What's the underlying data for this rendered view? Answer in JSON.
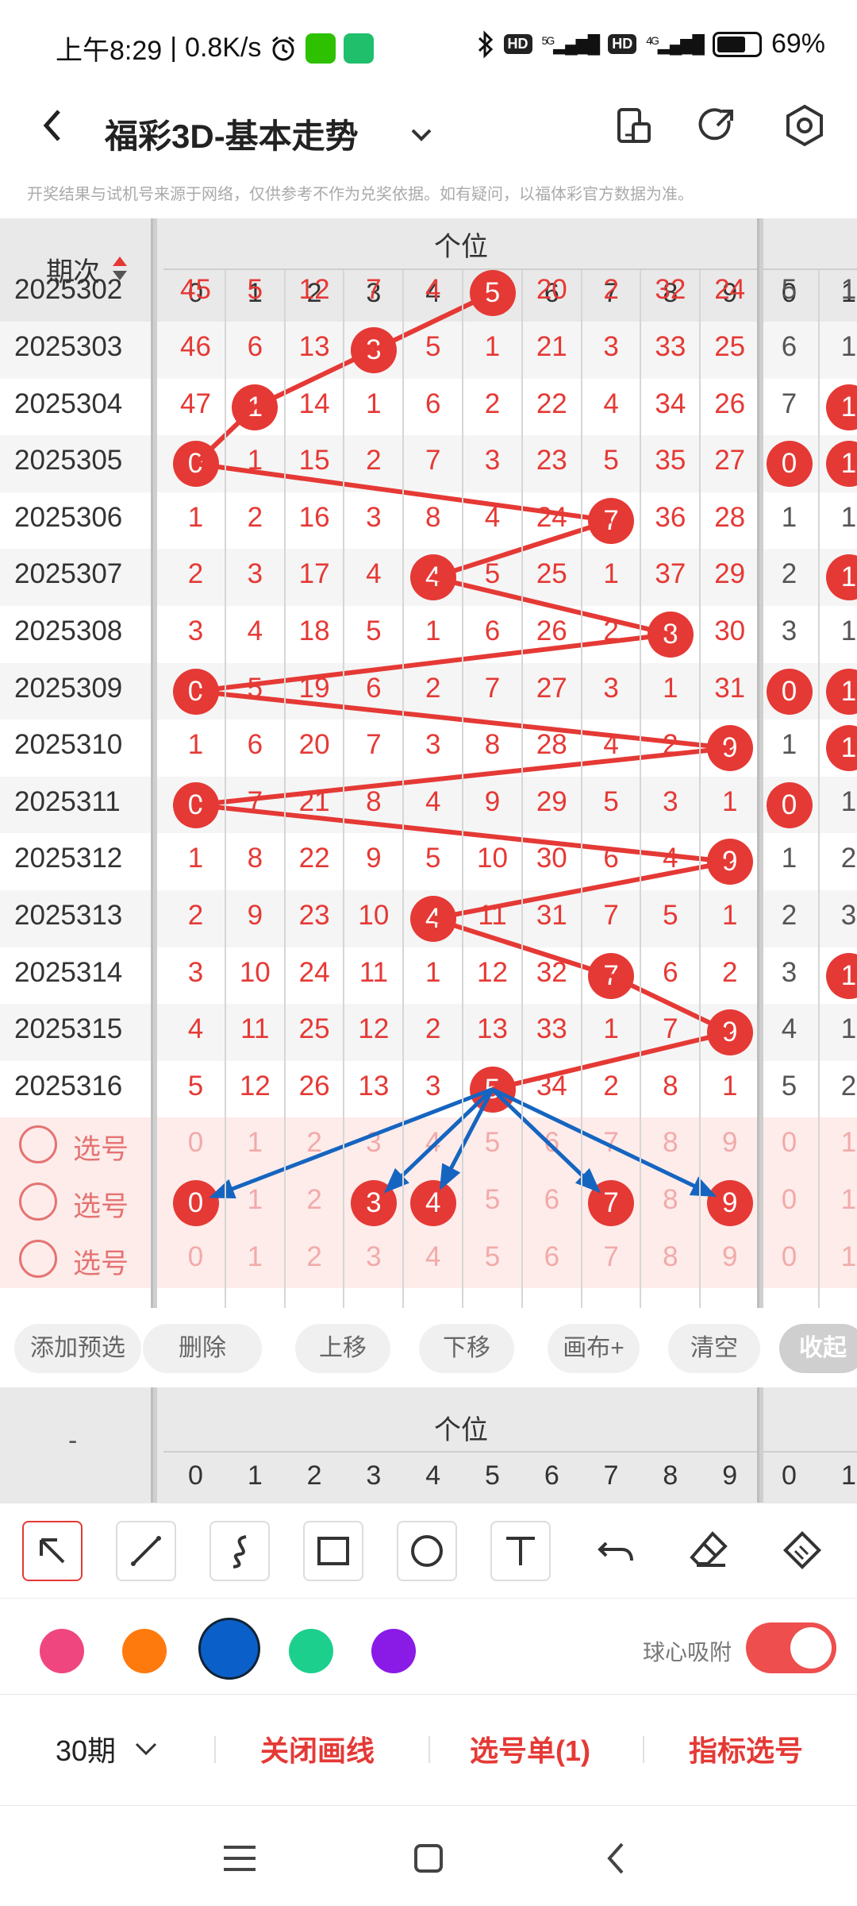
{
  "status_bar": {
    "time": "上午8:29",
    "speed": "0.8K/s",
    "net1": "5G",
    "net2": "4G",
    "hd": "HD",
    "battery": "69%"
  },
  "header": {
    "title": "福彩3D-基本走势",
    "back_icon": "chevron-left-icon"
  },
  "notice": "开奖结果与试机号来源于网络，仅供参考不作为兑奖依据。如有疑问，以福体彩官方数据为准。",
  "table": {
    "period_header": "期次",
    "group_header": "个位",
    "digits": [
      "0",
      "1",
      "2",
      "3",
      "4",
      "5",
      "6",
      "7",
      "8",
      "9"
    ],
    "extra_digits": [
      "0",
      "1"
    ],
    "partial_row": {
      "period": "2025302",
      "cells": [
        "45",
        "5",
        "12",
        "7",
        "4",
        "5",
        "20",
        "2",
        "32",
        "24"
      ],
      "ball": 5,
      "extra": [
        "5",
        "1"
      ]
    },
    "rows": [
      {
        "period": "2025303",
        "cells": [
          "46",
          "6",
          "13",
          "3",
          "5",
          "1",
          "21",
          "3",
          "33",
          "25"
        ],
        "ball": 3,
        "extra": [
          "6",
          "1"
        ],
        "extra_ball": [
          false,
          false
        ]
      },
      {
        "period": "2025304",
        "cells": [
          "47",
          "1",
          "14",
          "1",
          "6",
          "2",
          "22",
          "4",
          "34",
          "26"
        ],
        "ball": 1,
        "extra": [
          "7",
          "1"
        ],
        "extra_ball": [
          false,
          true
        ]
      },
      {
        "period": "2025305",
        "cells": [
          "0",
          "1",
          "15",
          "2",
          "7",
          "3",
          "23",
          "5",
          "35",
          "27"
        ],
        "ball": 0,
        "extra": [
          "0",
          "1"
        ],
        "extra_ball": [
          true,
          true
        ]
      },
      {
        "period": "2025306",
        "cells": [
          "1",
          "2",
          "16",
          "3",
          "8",
          "4",
          "24",
          "7",
          "36",
          "28"
        ],
        "ball": 7,
        "extra": [
          "1",
          "1"
        ],
        "extra_ball": [
          false,
          false
        ]
      },
      {
        "period": "2025307",
        "cells": [
          "2",
          "3",
          "17",
          "4",
          "4",
          "5",
          "25",
          "1",
          "37",
          "29"
        ],
        "ball": 4,
        "extra": [
          "2",
          "1"
        ],
        "extra_ball": [
          false,
          true
        ]
      },
      {
        "period": "2025308",
        "cells": [
          "3",
          "4",
          "18",
          "5",
          "1",
          "6",
          "26",
          "2",
          "8",
          "30"
        ],
        "ball": 8,
        "extra": [
          "3",
          "1"
        ],
        "extra_ball": [
          false,
          false
        ]
      },
      {
        "period": "2025309",
        "cells": [
          "0",
          "5",
          "19",
          "6",
          "2",
          "7",
          "27",
          "3",
          "1",
          "31"
        ],
        "ball": 0,
        "extra": [
          "0",
          "1"
        ],
        "extra_ball": [
          true,
          true
        ]
      },
      {
        "period": "2025310",
        "cells": [
          "1",
          "6",
          "20",
          "7",
          "3",
          "8",
          "28",
          "4",
          "2",
          "9"
        ],
        "ball": 9,
        "extra": [
          "1",
          "1"
        ],
        "extra_ball": [
          false,
          true
        ]
      },
      {
        "period": "2025311",
        "cells": [
          "0",
          "7",
          "21",
          "8",
          "4",
          "9",
          "29",
          "5",
          "3",
          "1"
        ],
        "ball": 0,
        "extra": [
          "0",
          "1"
        ],
        "extra_ball": [
          true,
          false
        ]
      },
      {
        "period": "2025312",
        "cells": [
          "1",
          "8",
          "22",
          "9",
          "5",
          "10",
          "30",
          "6",
          "4",
          "9"
        ],
        "ball": 9,
        "extra": [
          "1",
          "2"
        ],
        "extra_ball": [
          false,
          false
        ]
      },
      {
        "period": "2025313",
        "cells": [
          "2",
          "9",
          "23",
          "10",
          "4",
          "11",
          "31",
          "7",
          "5",
          "1"
        ],
        "ball": 4,
        "extra": [
          "2",
          "3"
        ],
        "extra_ball": [
          false,
          false
        ]
      },
      {
        "period": "2025314",
        "cells": [
          "3",
          "10",
          "24",
          "11",
          "1",
          "12",
          "32",
          "7",
          "6",
          "2"
        ],
        "ball": 7,
        "extra": [
          "3",
          "1"
        ],
        "extra_ball": [
          false,
          true
        ]
      },
      {
        "period": "2025315",
        "cells": [
          "4",
          "11",
          "25",
          "12",
          "2",
          "13",
          "33",
          "1",
          "7",
          "9"
        ],
        "ball": 9,
        "extra": [
          "4",
          "1"
        ],
        "extra_ball": [
          false,
          false
        ]
      },
      {
        "period": "2025316",
        "cells": [
          "5",
          "12",
          "26",
          "13",
          "3",
          "5",
          "34",
          "2",
          "8",
          "1"
        ],
        "ball": 5,
        "extra": [
          "5",
          "2"
        ],
        "extra_ball": [
          false,
          false
        ]
      }
    ],
    "select_label": "选号",
    "select_rows": [
      {
        "balls": []
      },
      {
        "balls": [
          0,
          3,
          4,
          7,
          9
        ]
      },
      {
        "balls": []
      }
    ]
  },
  "actions": [
    "添加预选",
    "删除",
    "上移",
    "下移",
    "画布+",
    "清空",
    "收起"
  ],
  "table2": {
    "period_header": "-",
    "group_header": "个位"
  },
  "tools": [
    "cursor-arrow-icon",
    "line-tool-icon",
    "curve-tool-icon",
    "rectangle-tool-icon",
    "circle-tool-icon",
    "text-tool-icon",
    "undo-icon",
    "eraser-icon",
    "clear-all-icon"
  ],
  "colors": {
    "swatches": [
      "#f0467f",
      "#ff7a0d",
      "#0b5fc9",
      "#1ccf8c",
      "#8a1ae6"
    ],
    "selected": "#0b5fc9",
    "accent": "#e53935",
    "arrow": "#1565c0"
  },
  "snap_label": "球心吸附",
  "snap_enabled": true,
  "bottom_bar": {
    "periods": "30期",
    "close_lines": "关闭画线",
    "ticket": "选号单(1)",
    "indicator": "指标选号"
  },
  "nav": [
    "menu-icon",
    "home-icon",
    "back-icon"
  ]
}
